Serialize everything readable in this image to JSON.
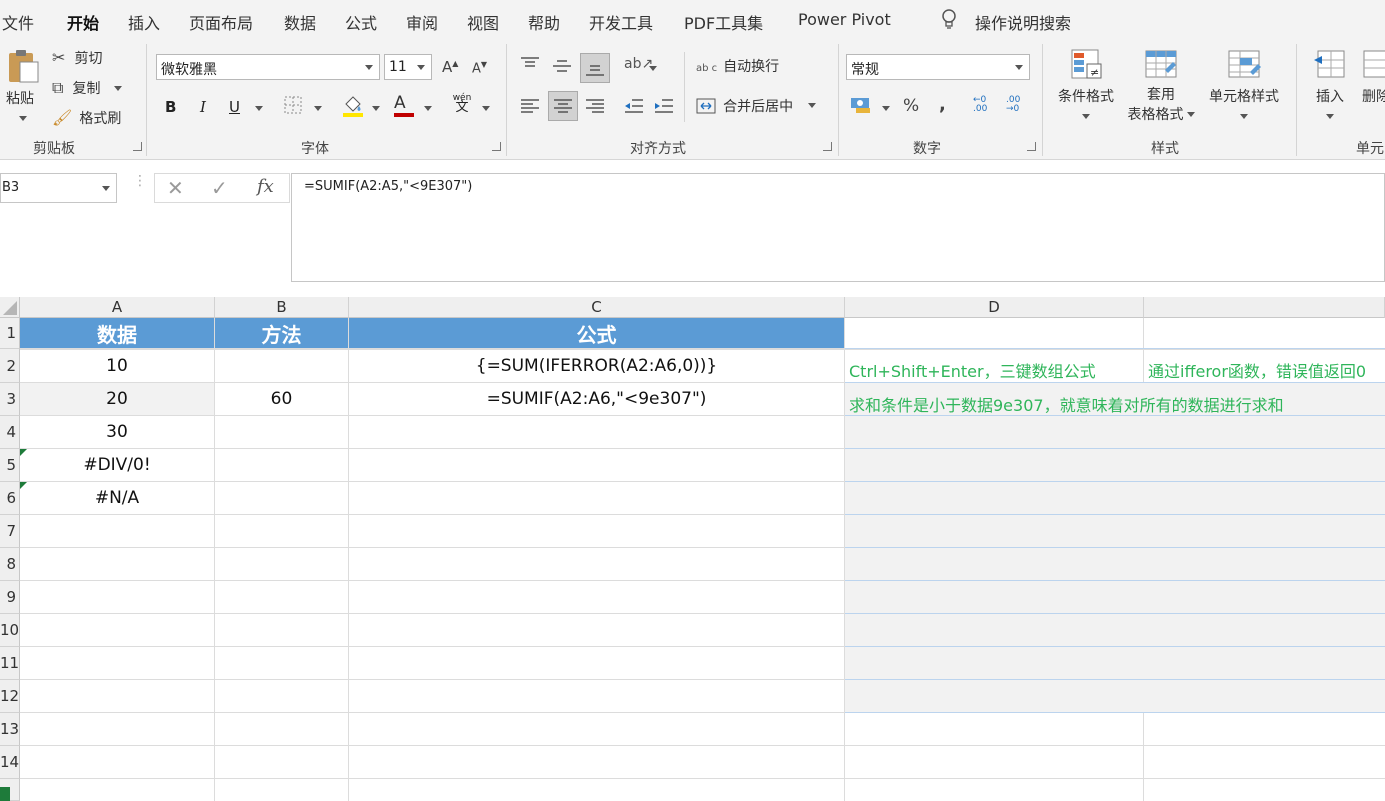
{
  "tabs": [
    "文件",
    "开始",
    "插入",
    "页面布局",
    "数据",
    "公式",
    "审阅",
    "视图",
    "帮助",
    "开发工具",
    "PDF工具集",
    "Power Pivot"
  ],
  "active_tab": "开始",
  "tell_me": "操作说明搜索",
  "clipboard": {
    "paste": "粘贴",
    "cut": "剪切",
    "copy": "复制",
    "format_painter": "格式刷",
    "group": "剪贴板"
  },
  "font": {
    "name": "微软雅黑",
    "size": "11",
    "bold": "B",
    "italic": "I",
    "underline": "U",
    "font_color_glyph": "A",
    "phonetic": "wén",
    "phonetic2": "文",
    "group": "字体"
  },
  "alignment": {
    "wrap": "自动换行",
    "merge": "合并后居中",
    "group": "对齐方式",
    "wrap_icon": "ab c"
  },
  "number": {
    "format": "常规",
    "percent": "%",
    "comma": ",",
    "inc_decimal": "←0 .00",
    "dec_decimal": ".00 →0",
    "group": "数字"
  },
  "styles": {
    "conditional": "条件格式",
    "table_format_1": "套用",
    "table_format_2": "表格格式",
    "cell_styles": "单元格样式",
    "group": "样式"
  },
  "cells": {
    "insert": "插入",
    "delete": "删除",
    "group": "单元"
  },
  "formula_bar": {
    "name_box": "B3",
    "formula": "=SUMIF(A2:A5,\"<9E307\")",
    "fx": "fx"
  },
  "columns": [
    "A",
    "B",
    "C",
    "D"
  ],
  "rows": [
    "1",
    "2",
    "3",
    "4",
    "5",
    "6",
    "7",
    "8",
    "9",
    "10",
    "11",
    "12",
    "13",
    "14"
  ],
  "grid": {
    "r1": [
      "数据",
      "方法",
      "公式"
    ],
    "r2": [
      "10",
      "",
      "{=SUM(IFERROR(A2:A6,0))}"
    ],
    "r3": [
      "20",
      "60",
      "=SUMIF(A2:A6,\"<9e307\")"
    ],
    "r4": [
      "30",
      "",
      ""
    ],
    "r5": [
      "#DIV/0!",
      "",
      ""
    ],
    "r6": [
      "#N/A",
      "",
      ""
    ]
  },
  "notes": {
    "d2a": "Ctrl+Shift+Enter，三键数组公式",
    "d2b": "通过ifferor函数，错误值返回0",
    "d3": "求和条件是小于数据9e307，就意味着对所有的数据进行求和"
  },
  "colors": {
    "header_fill": "#5b9bd5",
    "note_text": "#2fb55a",
    "accent": "#217346"
  }
}
